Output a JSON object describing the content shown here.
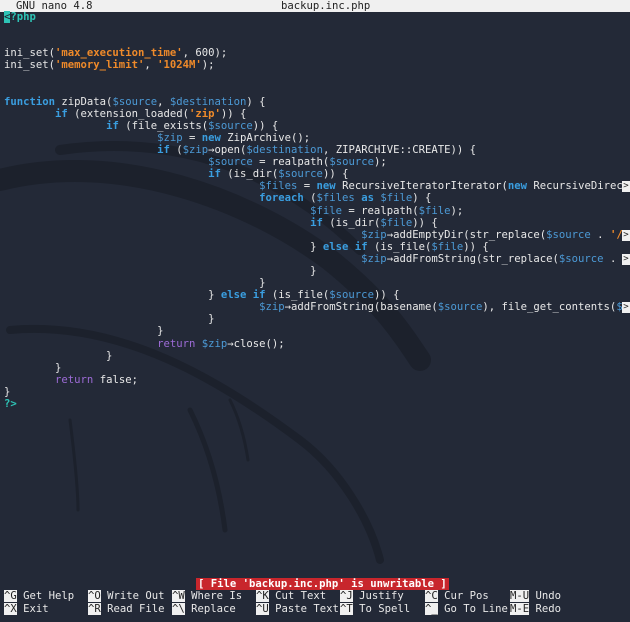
{
  "titlebar": {
    "app": "GNU nano 4.8",
    "filename": "backup.inc.php"
  },
  "editor": {
    "lines": [
      [
        {
          "t": "<",
          "c": "cursor"
        },
        {
          "t": "?php",
          "c": "tag"
        }
      ],
      [],
      [],
      [
        {
          "t": "ini_set("
        },
        {
          "t": "'max_execution_time'",
          "c": "str"
        },
        {
          "t": ", 600);"
        }
      ],
      [
        {
          "t": "ini_set("
        },
        {
          "t": "'memory_limit'",
          "c": "str"
        },
        {
          "t": ", "
        },
        {
          "t": "'1024M'",
          "c": "str"
        },
        {
          "t": ");"
        }
      ],
      [],
      [],
      [
        {
          "t": "function",
          "c": "kw"
        },
        {
          "t": " zipData("
        },
        {
          "t": "$source",
          "c": "var"
        },
        {
          "t": ", "
        },
        {
          "t": "$destination",
          "c": "var"
        },
        {
          "t": ") {"
        }
      ],
      [
        {
          "t": "        "
        },
        {
          "t": "if",
          "c": "kw"
        },
        {
          "t": " (extension_loaded("
        },
        {
          "t": "'zip'",
          "c": "str"
        },
        {
          "t": ")) {"
        }
      ],
      [
        {
          "t": "                "
        },
        {
          "t": "if",
          "c": "kw"
        },
        {
          "t": " (file_exists("
        },
        {
          "t": "$source",
          "c": "var"
        },
        {
          "t": ")) {"
        }
      ],
      [
        {
          "t": "                        "
        },
        {
          "t": "$zip",
          "c": "var"
        },
        {
          "t": " = "
        },
        {
          "t": "new",
          "c": "kw"
        },
        {
          "t": " ZipArchive();"
        }
      ],
      [
        {
          "t": "                        "
        },
        {
          "t": "if",
          "c": "kw"
        },
        {
          "t": " ("
        },
        {
          "t": "$zip",
          "c": "var"
        },
        {
          "t": "→open("
        },
        {
          "t": "$destination",
          "c": "var"
        },
        {
          "t": ", ZIPARCHIVE::CREATE)) {"
        }
      ],
      [
        {
          "t": "                                "
        },
        {
          "t": "$source",
          "c": "var"
        },
        {
          "t": " = realpath("
        },
        {
          "t": "$source",
          "c": "var"
        },
        {
          "t": ");"
        }
      ],
      [
        {
          "t": "                                "
        },
        {
          "t": "if",
          "c": "kw"
        },
        {
          "t": " (is_dir("
        },
        {
          "t": "$source",
          "c": "var"
        },
        {
          "t": ")) {"
        }
      ],
      [
        {
          "t": "                                        "
        },
        {
          "t": "$files",
          "c": "var"
        },
        {
          "t": " = "
        },
        {
          "t": "new",
          "c": "kw"
        },
        {
          "t": " RecursiveIteratorIterator("
        },
        {
          "t": "new",
          "c": "kw"
        },
        {
          "t": " RecursiveDirectoryI"
        }
      ],
      [
        {
          "t": "                                        "
        },
        {
          "t": "foreach",
          "c": "kw"
        },
        {
          "t": " ("
        },
        {
          "t": "$files",
          "c": "var"
        },
        {
          "t": " "
        },
        {
          "t": "as",
          "c": "kw"
        },
        {
          "t": " "
        },
        {
          "t": "$file",
          "c": "var"
        },
        {
          "t": ") {"
        }
      ],
      [
        {
          "t": "                                                "
        },
        {
          "t": "$file",
          "c": "var"
        },
        {
          "t": " = realpath("
        },
        {
          "t": "$file",
          "c": "var"
        },
        {
          "t": ");"
        }
      ],
      [
        {
          "t": "                                                "
        },
        {
          "t": "if",
          "c": "kw"
        },
        {
          "t": " (is_dir("
        },
        {
          "t": "$file",
          "c": "var"
        },
        {
          "t": ")) {"
        }
      ],
      [
        {
          "t": "                                                        "
        },
        {
          "t": "$zip",
          "c": "var"
        },
        {
          "t": "→addEmptyDir(str_replace("
        },
        {
          "t": "$source",
          "c": "var"
        },
        {
          "t": " . "
        },
        {
          "t": "'/'",
          "c": "str"
        },
        {
          "t": ", "
        },
        {
          "t": "'",
          "c": "str"
        }
      ],
      [
        {
          "t": "                                                "
        },
        {
          "t": "} "
        },
        {
          "t": "else if",
          "c": "kw"
        },
        {
          "t": " (is_file("
        },
        {
          "t": "$file",
          "c": "var"
        },
        {
          "t": ")) {"
        }
      ],
      [
        {
          "t": "                                                        "
        },
        {
          "t": "$zip",
          "c": "var"
        },
        {
          "t": "→addFromString(str_replace("
        },
        {
          "t": "$source",
          "c": "var"
        },
        {
          "t": " . "
        },
        {
          "t": "'/'",
          "c": "str"
        },
        {
          "t": ","
        }
      ],
      [
        {
          "t": "                                                }"
        }
      ],
      [
        {
          "t": "                                        }"
        }
      ],
      [
        {
          "t": "                                } "
        },
        {
          "t": "else if",
          "c": "kw"
        },
        {
          "t": " (is_file("
        },
        {
          "t": "$source",
          "c": "var"
        },
        {
          "t": ")) {"
        }
      ],
      [
        {
          "t": "                                        "
        },
        {
          "t": "$zip",
          "c": "var"
        },
        {
          "t": "→addFromString(basename("
        },
        {
          "t": "$source",
          "c": "var"
        },
        {
          "t": "), file_get_contents("
        },
        {
          "t": "$sour",
          "c": "var"
        }
      ],
      [
        {
          "t": "                                }"
        }
      ],
      [
        {
          "t": "                        }"
        }
      ],
      [
        {
          "t": "                        "
        },
        {
          "t": "return",
          "c": "ret"
        },
        {
          "t": " "
        },
        {
          "t": "$zip",
          "c": "var"
        },
        {
          "t": "→close();"
        }
      ],
      [
        {
          "t": "                }"
        }
      ],
      [
        {
          "t": "        }"
        }
      ],
      [
        {
          "t": "        "
        },
        {
          "t": "return",
          "c": "ret"
        },
        {
          "t": " false;"
        }
      ],
      [
        {
          "t": "}"
        }
      ],
      [
        {
          "t": "?>",
          "c": "tag"
        }
      ]
    ],
    "truncated_lines": [
      14,
      18,
      20,
      24
    ],
    "truncation_marker": ">"
  },
  "status": {
    "message": "[ File 'backup.inc.php' is unwritable ]"
  },
  "shortcuts": [
    {
      "key": "^G",
      "label": "Get Help"
    },
    {
      "key": "^X",
      "label": "Exit"
    },
    {
      "key": "^O",
      "label": "Write Out"
    },
    {
      "key": "^R",
      "label": "Read File"
    },
    {
      "key": "^W",
      "label": "Where Is"
    },
    {
      "key": "^\\",
      "label": "Replace"
    },
    {
      "key": "^K",
      "label": "Cut Text"
    },
    {
      "key": "^U",
      "label": "Paste Text"
    },
    {
      "key": "^J",
      "label": "Justify"
    },
    {
      "key": "^T",
      "label": "To Spell"
    },
    {
      "key": "^C",
      "label": "Cur Pos"
    },
    {
      "key": "^_",
      "label": "Go To Line"
    },
    {
      "key": "M-U",
      "label": "Undo"
    },
    {
      "key": "M-E",
      "label": "Redo"
    }
  ],
  "colors": {
    "background": "#232937",
    "keyword": "#3a9ee0",
    "variable": "#4c9ad6",
    "string": "#ef8a2a",
    "return": "#9c6bd6",
    "php_tag": "#2ec4b6",
    "status_bg": "#c8262c"
  }
}
